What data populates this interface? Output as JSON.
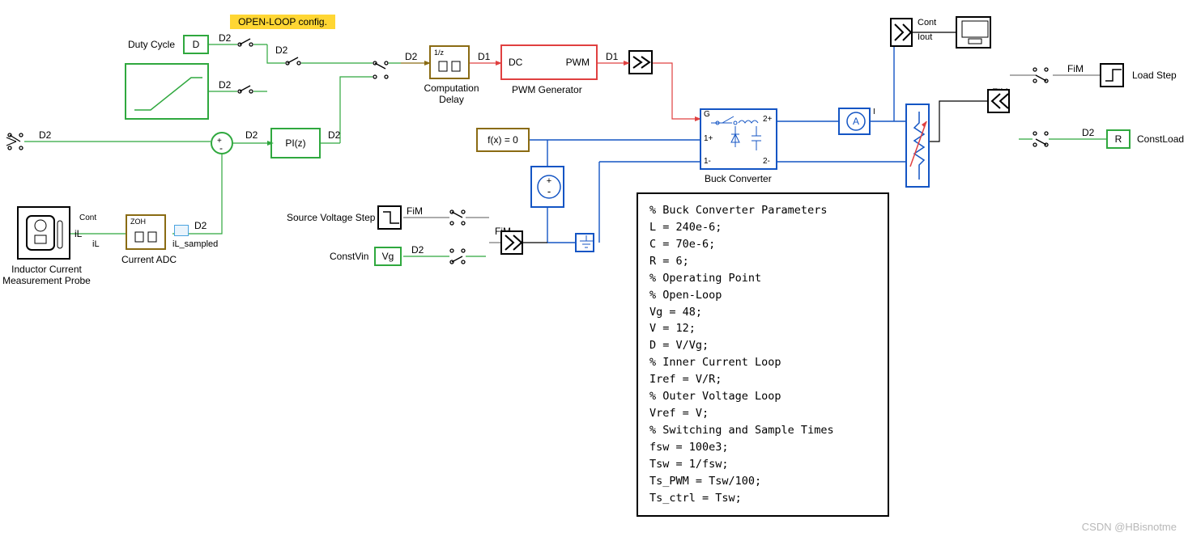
{
  "banner": "OPEN-LOOP config.",
  "labels": {
    "dutyCycle": "Duty Cycle",
    "D": "D",
    "compDelay": "Computation Delay",
    "pwmGen": "PWM Generator",
    "dc": "DC",
    "pwm": "PWM",
    "pi": "PI(z)",
    "fx0": "f(x) = 0",
    "buckConv": "Buck Converter",
    "srcVStep": "Source Voltage Step",
    "constVin": "ConstVin",
    "vg": "Vg",
    "ilProbe": "Inductor Current Measurement Probe",
    "iL": "iL",
    "iLsamp": "iL_sampled",
    "curADC": "Current ADC",
    "zoh": "ZOH",
    "cont": "Cont",
    "iout": "Iout",
    "I": "I",
    "R": "R",
    "constLoad": "ConstLoad",
    "loadStep": "Load Step",
    "zdelay": "1/z",
    "g": "G",
    "p2": "2+",
    "p1p": "1+",
    "p1m": "1-",
    "p2m": "2-"
  },
  "rates": {
    "D2": "D2",
    "D1": "D1",
    "FiM": "FiM"
  },
  "code": "% Buck Converter Parameters\nL = 240e-6;\nC = 70e-6;\nR = 6;\n% Operating Point\n% Open-Loop\nVg = 48;\nV = 12;\nD = V/Vg;\n% Inner Current Loop\nIref = V/R;\n% Outer Voltage Loop\nVref = V;\n% Switching and Sample Times\nfsw = 100e3;\nTsw = 1/fsw;\nTs_PWM = Tsw/100;\nTs_ctrl = Tsw;",
  "watermark": "CSDN @HBisnotme",
  "colors": {
    "green": "#2fa83e",
    "blue": "#1455c4",
    "red": "#e04040",
    "brown": "#8a6b13",
    "black": "#000"
  }
}
